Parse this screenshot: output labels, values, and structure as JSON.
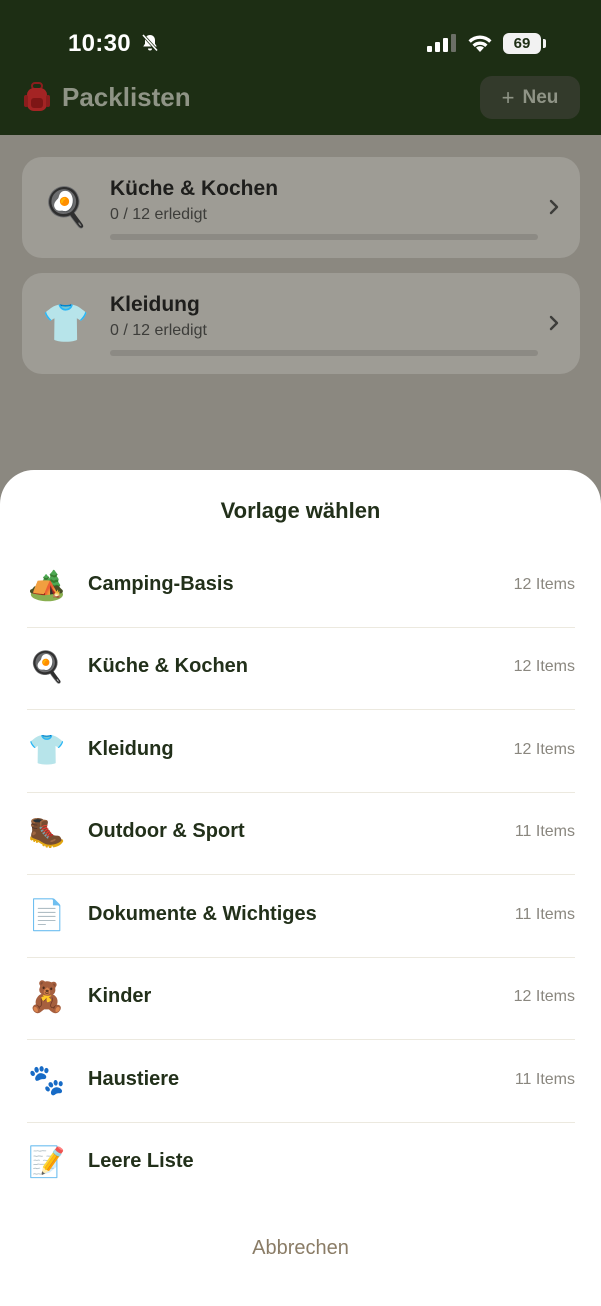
{
  "status_bar": {
    "time": "10:30",
    "battery": "69"
  },
  "app_bar": {
    "icon": "backpack-icon",
    "title": "Packlisten",
    "new_button": {
      "plus": "+",
      "label": "Neu"
    }
  },
  "lists": [
    {
      "icon": "frying-pan-icon",
      "emoji": "🍳",
      "title": "Küche & Kochen",
      "status": "0 / 12 erledigt",
      "progress": 0
    },
    {
      "icon": "shirt-icon",
      "emoji": "👕",
      "title": "Kleidung",
      "status": "0 / 12 erledigt",
      "progress": 0
    }
  ],
  "sheet": {
    "title": "Vorlage wählen",
    "templates": [
      {
        "icon": "tent-icon",
        "emoji": "🏕️",
        "name": "Camping-Basis",
        "count": "12 Items"
      },
      {
        "icon": "frying-pan-icon",
        "emoji": "🍳",
        "name": "Küche & Kochen",
        "count": "12 Items"
      },
      {
        "icon": "shirt-icon",
        "emoji": "👕",
        "name": "Kleidung",
        "count": "12 Items"
      },
      {
        "icon": "hiking-boot-icon",
        "emoji": "🥾",
        "name": "Outdoor & Sport",
        "count": "11 Items"
      },
      {
        "icon": "document-icon",
        "emoji": "📄",
        "name": "Dokumente & Wichtiges",
        "count": "11 Items"
      },
      {
        "icon": "teddy-bear-icon",
        "emoji": "🧸",
        "name": "Kinder",
        "count": "12 Items"
      },
      {
        "icon": "paw-prints-icon",
        "emoji": "🐾",
        "name": "Haustiere",
        "count": "11 Items"
      },
      {
        "icon": "memo-icon",
        "emoji": "📝",
        "name": "Leere Liste",
        "count": ""
      }
    ],
    "cancel_label": "Abbrechen"
  },
  "colors": {
    "header_bg": "#1d2e14",
    "sheet_text": "#22301a",
    "cancel_text": "#8a7c66"
  }
}
